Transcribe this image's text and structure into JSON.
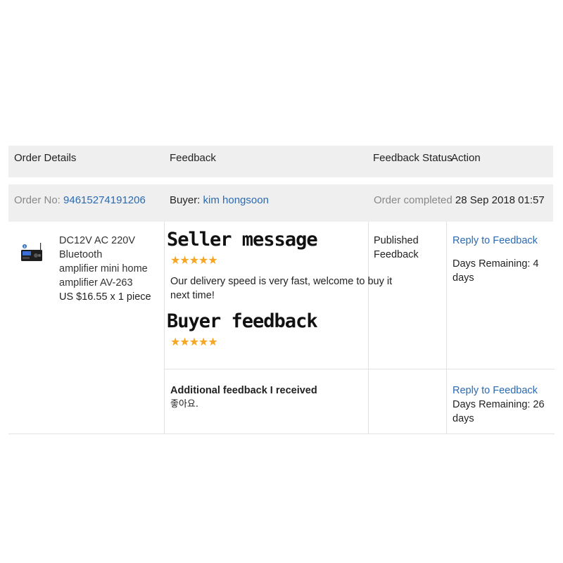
{
  "header": {
    "col_order_details": "Order Details",
    "col_feedback": "Feedback",
    "col_feedback_status": "Feedback Status",
    "col_action": "Action"
  },
  "summary": {
    "order_no_label": "Order No:",
    "order_no": "94615274191206",
    "buyer_label": "Buyer:",
    "buyer_name": "kim hongsoon",
    "status_label": "Order completed",
    "status_date": "28 Sep 2018 01:57"
  },
  "product": {
    "title_line1": "DC12V AC 220V Bluetooth",
    "title_line2": "amplifier mini home",
    "title_line3": "amplifier AV-263",
    "price": "US $16.55 x 1 piece",
    "icon": "amplifier-product-image"
  },
  "feedback": {
    "seller_heading": "Seller message",
    "seller_stars": "★★★★★",
    "seller_message_line1": "Our delivery speed is very fast, welcome to buy it",
    "seller_message_line2": "next time!",
    "buyer_heading": "Buyer feedback",
    "buyer_stars": "★★★★★",
    "additional_label": "Additional feedback I received",
    "additional_text": "좋아요."
  },
  "status": {
    "line1": "Published",
    "line2": "Feedback"
  },
  "actions": {
    "reply_label_1": "Reply to Feedback",
    "days_remaining_1": "Days Remaining: 4 days",
    "reply_label_2": "Reply to Feedback",
    "days_remaining_2": "Days Remaining: 26 days"
  },
  "colors": {
    "link": "#2a6ab3",
    "star": "#f5a623",
    "header_bg": "#efefef"
  }
}
